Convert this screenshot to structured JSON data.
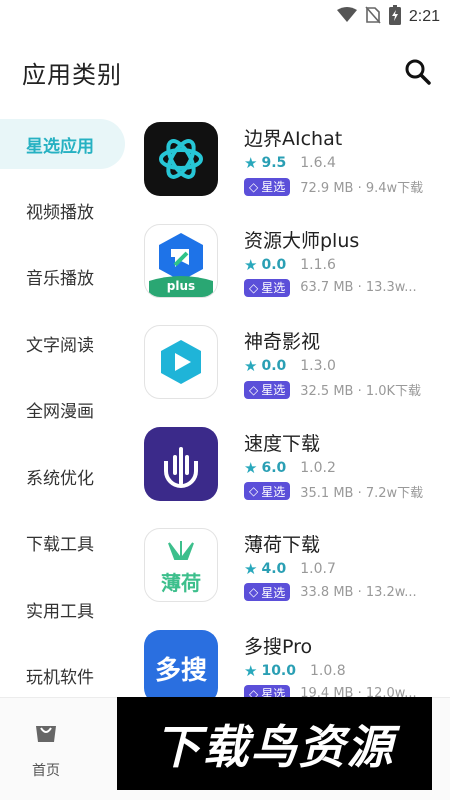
{
  "status_bar": {
    "time": "2:21",
    "icons": [
      "wifi-icon",
      "no-sim-icon",
      "battery-charging-icon"
    ]
  },
  "header": {
    "title": "应用类别",
    "search_icon": "search-icon"
  },
  "sidebar": {
    "items": [
      {
        "label": "星选应用",
        "active": true
      },
      {
        "label": "视频播放",
        "active": false
      },
      {
        "label": "音乐播放",
        "active": false
      },
      {
        "label": "文字阅读",
        "active": false
      },
      {
        "label": "全网漫画",
        "active": false
      },
      {
        "label": "系统优化",
        "active": false
      },
      {
        "label": "下载工具",
        "active": false
      },
      {
        "label": "实用工具",
        "active": false
      },
      {
        "label": "玩机软件",
        "active": false
      }
    ]
  },
  "apps": [
    {
      "name": "边界AIchat",
      "score": "9.5",
      "version": "1.6.4",
      "badge": "星选",
      "meta": "72.9 MB · 9.4w下载"
    },
    {
      "name": "资源大师plus",
      "score": "0.0",
      "version": "1.1.6",
      "badge": "星选",
      "meta": "63.7 MB · 13.3w..."
    },
    {
      "name": "神奇影视",
      "score": "0.0",
      "version": "1.3.0",
      "badge": "星选",
      "meta": "32.5 MB · 1.0K下载"
    },
    {
      "name": "速度下载",
      "score": "6.0",
      "version": "1.0.2",
      "badge": "星选",
      "meta": "35.1 MB · 7.2w下载"
    },
    {
      "name": "薄荷下载",
      "score": "4.0",
      "version": "1.0.7",
      "badge": "星选",
      "meta": "33.8 MB · 13.2w..."
    },
    {
      "name": "多搜Pro",
      "score": "10.0",
      "version": "1.0.8",
      "badge": "星选",
      "meta": "19.4 MB · 12.0w..."
    }
  ],
  "icon_labels": {
    "app2": "plus",
    "app5": "薄荷",
    "app6": "多搜"
  },
  "bottom_nav": {
    "home_label": "首页",
    "home_icon": "shopping-bag-icon"
  },
  "watermark": {
    "text": "下载鸟资源"
  },
  "colors": {
    "accent": "#26b1c2",
    "badge": "#5b4fd9",
    "active_bg": "#e8f6f8"
  }
}
